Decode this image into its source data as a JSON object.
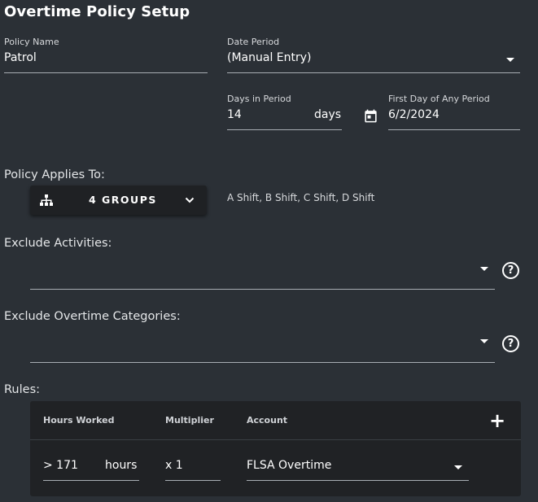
{
  "title": "Overtime Policy Setup",
  "policy_name": {
    "label": "Policy Name",
    "value": "Patrol"
  },
  "date_period": {
    "label": "Date Period",
    "value": "(Manual Entry)"
  },
  "days_in_period": {
    "label": "Days in Period",
    "value": "14",
    "suffix": "days"
  },
  "first_day": {
    "label": "First Day of Any Period",
    "value": "6/2/2024"
  },
  "applies_to": {
    "label": "Policy Applies To:",
    "button_label": "4 GROUPS",
    "summary": "A Shift, B Shift, C Shift, D Shift"
  },
  "exclude_activities": {
    "label": "Exclude Activities:",
    "value": ""
  },
  "exclude_overtime": {
    "label": "Exclude Overtime Categories:",
    "value": ""
  },
  "rules": {
    "label": "Rules:",
    "headers": [
      "Hours Worked",
      "Multiplier",
      "Account"
    ],
    "rows": [
      {
        "hours_worked": "> 171",
        "hours_suffix": "hours",
        "multiplier": "x 1",
        "account": "FLSA Overtime"
      }
    ]
  },
  "icons": {
    "groups": "org-chart-icon",
    "calendar": "calendar-icon",
    "help": "help-circle-icon",
    "add": "plus-icon",
    "dropdown": "caret-down-icon",
    "chevron": "chevron-down-icon"
  },
  "colors": {
    "background": "#2b3036",
    "panel": "#202225",
    "text": "#ffffff"
  }
}
